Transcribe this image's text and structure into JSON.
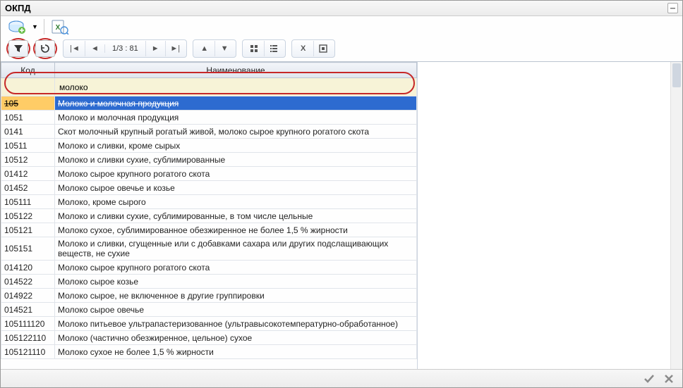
{
  "window": {
    "title": "ОКПД"
  },
  "pager": {
    "text": "1/3 : 81"
  },
  "filter": {
    "code": "",
    "name": "молоко"
  },
  "columns": {
    "code": "Код",
    "name": "Наименование"
  },
  "rows": [
    {
      "code": "105",
      "name": "Молоко и молочная продукция",
      "selected": true
    },
    {
      "code": "1051",
      "name": "Молоко и молочная продукция"
    },
    {
      "code": "0141",
      "name": "Скот молочный крупный рогатый живой, молоко сырое крупного рогатого скота"
    },
    {
      "code": "10511",
      "name": "Молоко и сливки, кроме сырых"
    },
    {
      "code": "10512",
      "name": "Молоко и сливки сухие, сублимированные"
    },
    {
      "code": "01412",
      "name": "Молоко сырое крупного рогатого скота"
    },
    {
      "code": "01452",
      "name": "Молоко сырое овечье и козье"
    },
    {
      "code": "105111",
      "name": "Молоко, кроме сырого"
    },
    {
      "code": "105122",
      "name": "Молоко и сливки сухие, сублимированные, в том числе цельные"
    },
    {
      "code": "105121",
      "name": "Молоко сухое, сублимированное обезжиренное не более 1,5 % жирности"
    },
    {
      "code": "105151",
      "name": "Молоко и сливки, сгущенные или с добавками сахара или других подслащивающих веществ, не сухие"
    },
    {
      "code": "014120",
      "name": "Молоко сырое крупного рогатого скота"
    },
    {
      "code": "014522",
      "name": "Молоко сырое козье"
    },
    {
      "code": "014922",
      "name": "Молоко сырое, не включенное в другие группировки"
    },
    {
      "code": "014521",
      "name": "Молоко сырое овечье"
    },
    {
      "code": "105111120",
      "name": "Молоко питьевое ультрапастеризованное (ультравысокотемпературно-обработанное)"
    },
    {
      "code": "105122110",
      "name": "Молоко (частично обезжиренное, цельное) сухое"
    },
    {
      "code": "105121110",
      "name": "Молоко сухое не более 1,5 % жирности"
    }
  ]
}
